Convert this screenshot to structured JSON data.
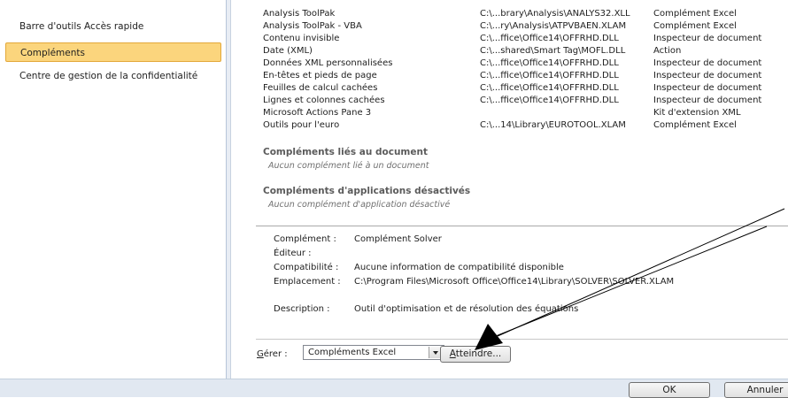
{
  "sidebar": {
    "items": [
      {
        "label": "Barre d'outils Accès rapide",
        "selected": false
      },
      {
        "label": "Compléments",
        "selected": true
      },
      {
        "label": "Centre de gestion de la confidentialité",
        "selected": false
      }
    ]
  },
  "addins": {
    "rows": [
      {
        "name": "Analysis ToolPak",
        "location": "C:\\...brary\\Analysis\\ANALYS32.XLL",
        "type": "Complément Excel"
      },
      {
        "name": "Analysis ToolPak - VBA",
        "location": "C:\\...ry\\Analysis\\ATPVBAEN.XLAM",
        "type": "Complément Excel"
      },
      {
        "name": "Contenu invisible",
        "location": "C:\\...ffice\\Office14\\OFFRHD.DLL",
        "type": "Inspecteur de document"
      },
      {
        "name": "Date (XML)",
        "location": "C:\\...shared\\Smart Tag\\MOFL.DLL",
        "type": "Action"
      },
      {
        "name": "Données XML personnalisées",
        "location": "C:\\...ffice\\Office14\\OFFRHD.DLL",
        "type": "Inspecteur de document"
      },
      {
        "name": "En-têtes et pieds de page",
        "location": "C:\\...ffice\\Office14\\OFFRHD.DLL",
        "type": "Inspecteur de document"
      },
      {
        "name": "Feuilles de calcul cachées",
        "location": "C:\\...ffice\\Office14\\OFFRHD.DLL",
        "type": "Inspecteur de document"
      },
      {
        "name": "Lignes et colonnes cachées",
        "location": "C:\\...ffice\\Office14\\OFFRHD.DLL",
        "type": "Inspecteur de document"
      },
      {
        "name": "Microsoft Actions Pane 3",
        "location": "",
        "type": "Kit d'extension XML"
      },
      {
        "name": "Outils pour l'euro",
        "location": "C:\\...14\\Library\\EUROTOOL.XLAM",
        "type": "Complément Excel"
      }
    ],
    "doc_section_title": "Compléments liés au document",
    "doc_section_empty": "Aucun complément lié à un document",
    "disabled_section_title": "Compléments d'applications désactivés",
    "disabled_section_empty": "Aucun complément d'application désactivé"
  },
  "details": {
    "addin_label": "Complément :",
    "addin_value": "Complément Solver",
    "publisher_label": "Éditeur :",
    "publisher_value": "",
    "compat_label": "Compatibilité :",
    "compat_value": "Aucune information de compatibilité disponible",
    "location_label": "Emplacement :",
    "location_value": "C:\\Program Files\\Microsoft Office\\Office14\\Library\\SOLVER\\SOLVER.XLAM",
    "description_label": "Description :",
    "description_value": "Outil d'optimisation et de résolution des équations"
  },
  "manage": {
    "label_accel": "G",
    "label_rest": "érer :",
    "selected_option": "Compléments Excel",
    "go_accel": "A",
    "go_rest": "tteindre..."
  },
  "footer": {
    "ok_label": "OK",
    "cancel_label": "Annuler"
  },
  "colors": {
    "selected_bg": "#fbd57d",
    "selected_border": "#e3a839",
    "footer_bg": "#e1e8f1"
  }
}
